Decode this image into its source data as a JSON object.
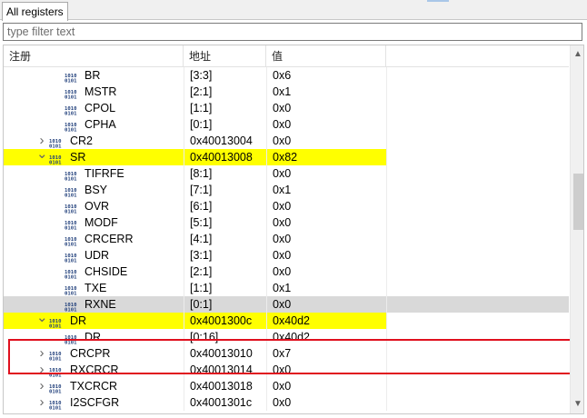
{
  "tab": {
    "label": "All registers"
  },
  "filter": {
    "placeholder": "type filter text",
    "value": ""
  },
  "columns": {
    "name": "注册",
    "address": "地址",
    "value": "值"
  },
  "colors": {
    "highlight": "#ffff00",
    "selected": "#d9d9d9",
    "annotation_box": "#e0101e"
  },
  "rows": [
    {
      "name": "BR",
      "address": "[3:3]",
      "value": "0x6",
      "level": 2,
      "kind": "field"
    },
    {
      "name": "MSTR",
      "address": "[2:1]",
      "value": "0x1",
      "level": 2,
      "kind": "field"
    },
    {
      "name": "CPOL",
      "address": "[1:1]",
      "value": "0x0",
      "level": 2,
      "kind": "field"
    },
    {
      "name": "CPHA",
      "address": "[0:1]",
      "value": "0x0",
      "level": 2,
      "kind": "field"
    },
    {
      "name": "CR2",
      "address": "0x40013004",
      "value": "0x0",
      "level": 1,
      "kind": "register",
      "expander": "collapsed"
    },
    {
      "name": "SR",
      "address": "0x40013008",
      "value": "0x82",
      "level": 1,
      "kind": "register",
      "expander": "expanded",
      "highlighted": true
    },
    {
      "name": "TIFRFE",
      "address": "[8:1]",
      "value": "0x0",
      "level": 2,
      "kind": "field"
    },
    {
      "name": "BSY",
      "address": "[7:1]",
      "value": "0x1",
      "level": 2,
      "kind": "field"
    },
    {
      "name": "OVR",
      "address": "[6:1]",
      "value": "0x0",
      "level": 2,
      "kind": "field"
    },
    {
      "name": "MODF",
      "address": "[5:1]",
      "value": "0x0",
      "level": 2,
      "kind": "field"
    },
    {
      "name": "CRCERR",
      "address": "[4:1]",
      "value": "0x0",
      "level": 2,
      "kind": "field"
    },
    {
      "name": "UDR",
      "address": "[3:1]",
      "value": "0x0",
      "level": 2,
      "kind": "field"
    },
    {
      "name": "CHSIDE",
      "address": "[2:1]",
      "value": "0x0",
      "level": 2,
      "kind": "field"
    },
    {
      "name": "TXE",
      "address": "[1:1]",
      "value": "0x1",
      "level": 2,
      "kind": "field"
    },
    {
      "name": "RXNE",
      "address": "[0:1]",
      "value": "0x0",
      "level": 2,
      "kind": "field",
      "selected": true
    },
    {
      "name": "DR",
      "address": "0x4001300c",
      "value": "0x40d2",
      "level": 1,
      "kind": "register",
      "expander": "expanded",
      "highlighted": true
    },
    {
      "name": "DR",
      "address": "[0:16]",
      "value": "0x40d2",
      "level": 2,
      "kind": "field"
    },
    {
      "name": "CRCPR",
      "address": "0x40013010",
      "value": "0x7",
      "level": 1,
      "kind": "register",
      "expander": "collapsed"
    },
    {
      "name": "RXCRCR",
      "address": "0x40013014",
      "value": "0x0",
      "level": 1,
      "kind": "register",
      "expander": "collapsed"
    },
    {
      "name": "TXCRCR",
      "address": "0x40013018",
      "value": "0x0",
      "level": 1,
      "kind": "register",
      "expander": "collapsed"
    },
    {
      "name": "I2SCFGR",
      "address": "0x4001301c",
      "value": "0x0",
      "level": 1,
      "kind": "register",
      "expander": "collapsed"
    }
  ],
  "scrollbar": {
    "position_fraction": 0.35,
    "visible_fraction": 0.15
  }
}
